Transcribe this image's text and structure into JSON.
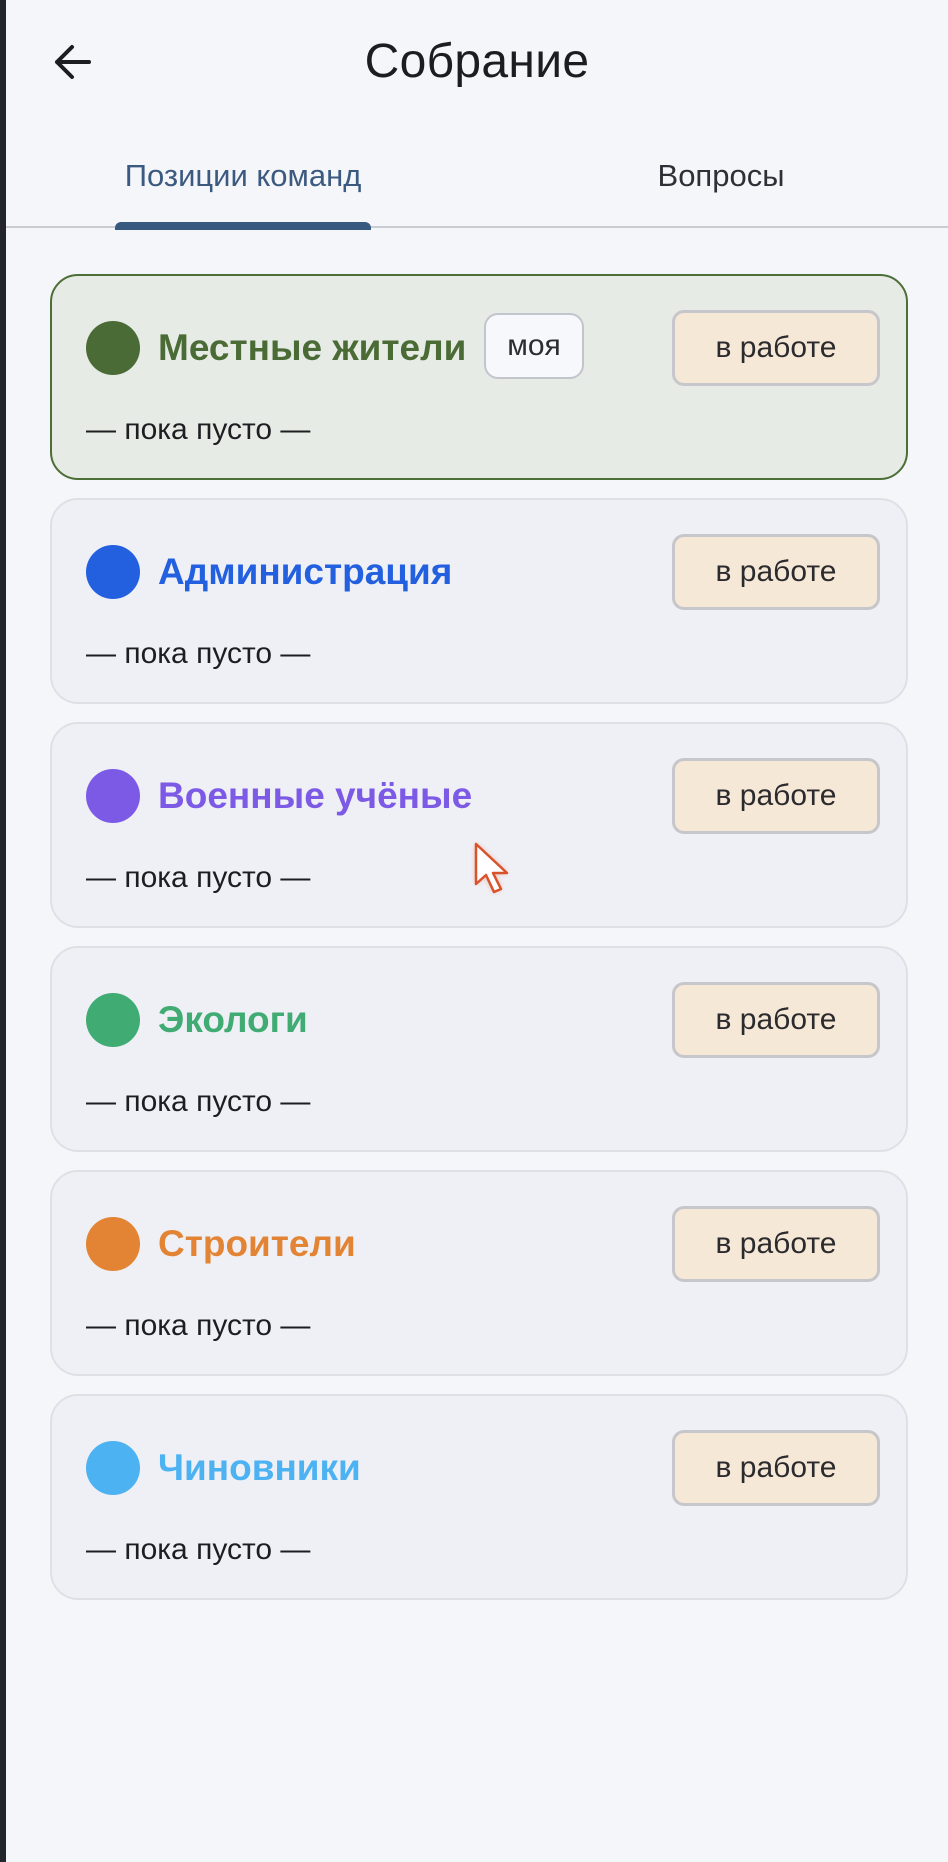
{
  "header": {
    "title": "Собрание",
    "back_icon": "arrow-left-icon"
  },
  "tabs": [
    {
      "label": "Позиции команд",
      "active": true
    },
    {
      "label": "Вопросы",
      "active": false
    }
  ],
  "teams": [
    {
      "name": "Местные жители",
      "color": "#4a6b35",
      "badge": "моя",
      "status": "в работе",
      "empty_text": "— пока пусто —",
      "mine": true
    },
    {
      "name": "Администрация",
      "color": "#2360e0",
      "status": "в работе",
      "empty_text": "— пока пусто —"
    },
    {
      "name": "Военные учёные",
      "color": "#7c5ae6",
      "status": "в работе",
      "empty_text": "— пока пусто —"
    },
    {
      "name": "Экологи",
      "color": "#40ab73",
      "status": "в работе",
      "empty_text": "— пока пусто —"
    },
    {
      "name": "Строители",
      "color": "#e28434",
      "status": "в работе",
      "empty_text": "— пока пусто —"
    },
    {
      "name": "Чиновники",
      "color": "#4cb2f2",
      "status": "в работе",
      "empty_text": "— пока пусто —"
    }
  ],
  "colors": {
    "tab_active": "#3c5a7f",
    "status_bg": "#f6e8d7",
    "mine_border": "#4c6e37"
  }
}
